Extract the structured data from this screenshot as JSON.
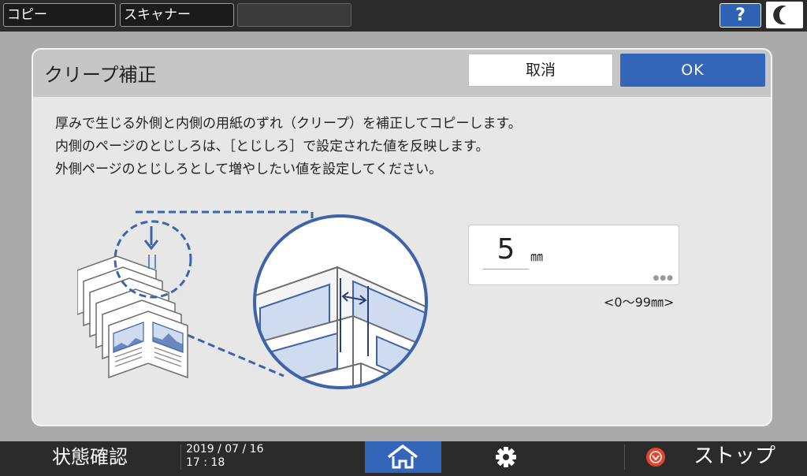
{
  "top_tabs": [
    {
      "label": "コピー"
    },
    {
      "label": "スキャナー"
    },
    {
      "label": ""
    }
  ],
  "help": {
    "label": "?",
    "icon": "help-icon"
  },
  "sleep": {
    "icon": "moon-icon"
  },
  "dialog": {
    "title": "クリープ補正",
    "cancel_label": "取消",
    "ok_label": "OK",
    "description": [
      "厚みで生じる外側と内側の用紙のずれ（クリープ）を補正してコピーします。",
      "内側のページのとじしろは、［とじしろ］で設定された値を反映します。",
      "外側ページのとじしろとして増やしたい値を設定してください。"
    ],
    "value": "5",
    "unit": "㎜",
    "range": "<0〜99㎜>"
  },
  "bottom": {
    "status_label": "状態確認",
    "date": "2019 / 07 / 16",
    "time": "17 : 18",
    "home_icon": "home-icon",
    "settings_icon": "gear-icon",
    "stop_icon": "stop-icon",
    "stop_label": "ストップ"
  },
  "colors": {
    "accent": "#3366b8",
    "illustration_blue": "#3d64a8",
    "stop_red": "#e3462d"
  }
}
